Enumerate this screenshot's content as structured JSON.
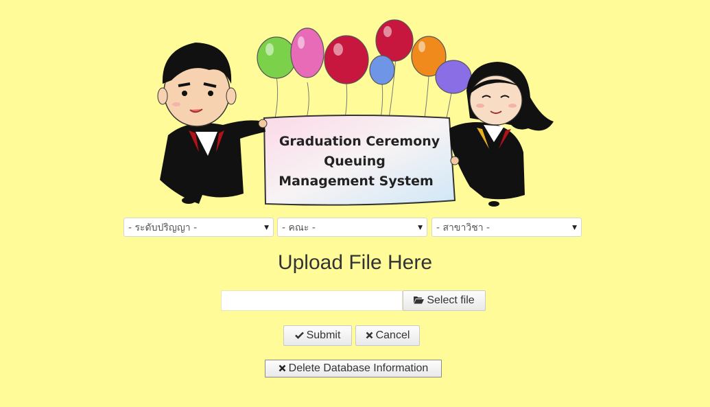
{
  "banner": {
    "line1": "Graduation Ceremony",
    "line2": "Queuing",
    "line3": "Management System"
  },
  "filters": {
    "degree_level": "- ระดับปริญญา -",
    "faculty": "- คณะ -",
    "major": "- สาขาวิชา -"
  },
  "upload": {
    "title": "Upload File Here",
    "file_value": "",
    "select_file_label": "Select file",
    "select_file_icon": "folder-open-icon"
  },
  "actions": {
    "submit_label": "Submit",
    "submit_icon": "check-icon",
    "cancel_label": "Cancel",
    "cancel_icon": "close-icon",
    "delete_label": "Delete Database Information",
    "delete_icon": "close-icon"
  },
  "colors": {
    "background": "#fffb99",
    "balloons": [
      "#7bd24a",
      "#e86bb8",
      "#c8173f",
      "#6f95e6",
      "#c8173f",
      "#f08a1c",
      "#8a6ee6"
    ]
  }
}
